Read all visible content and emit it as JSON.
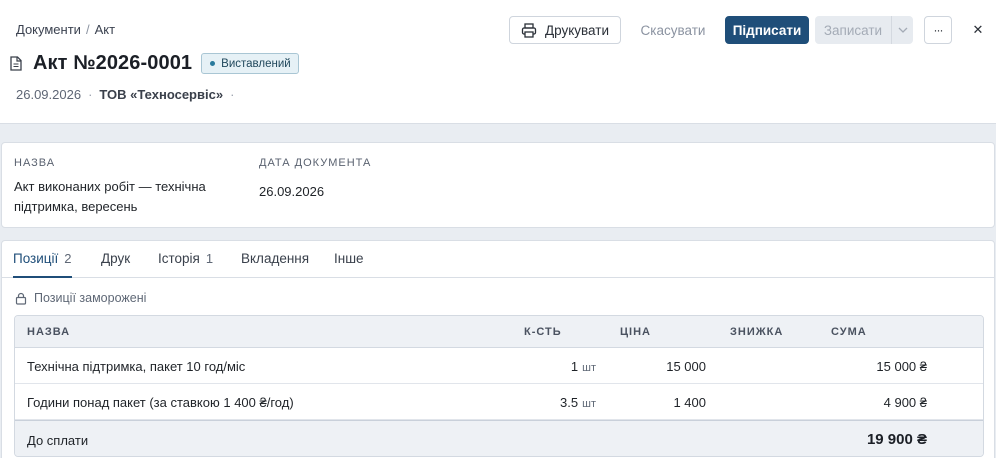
{
  "breadcrumb": {
    "parent": "Документи",
    "separator": "/",
    "current": "Акт"
  },
  "document": {
    "title": "Акт №2026-0001",
    "status": "Виставлений",
    "date": "26.09.2026",
    "organization": "ТОВ «Техносервіс»",
    "meta_separator": "·"
  },
  "toolbar": {
    "print_label": "Друкувати",
    "cancel_label": "Скасувати",
    "sign_label": "Підписати",
    "save_label": "Записати",
    "more_label": "···",
    "close_label": "✕"
  },
  "fields": {
    "name_label": "НАЗВА",
    "name_line1": "Акт виконаних робіт — технічна",
    "name_line2": "підтримка, вересень",
    "date_label": "ДАТА ДОКУМЕНТА",
    "date_value": "26.09.2026"
  },
  "tabs": [
    {
      "label": "Позиції",
      "count": "2",
      "active": true
    },
    {
      "label": "Друк",
      "count": ""
    },
    {
      "label": "Історія",
      "count": "1"
    },
    {
      "label": "Вкладення",
      "count": ""
    },
    {
      "label": "Інше",
      "count": ""
    }
  ],
  "positions": {
    "frozen_notice": "Позиції заморожені",
    "columns": {
      "name": "НАЗВА",
      "qty": "К-СТЬ",
      "price": "ЦІНА",
      "discount": "ЗНИЖКА",
      "sum": "СУМА"
    },
    "rows": [
      {
        "name": "Технічна підтримка, пакет 10 год/міс",
        "qty": "1",
        "unit": "шт",
        "price": "15 000",
        "discount": "",
        "sum": "15 000 ₴"
      },
      {
        "name": "Години понад пакет (за ставкою 1 400 ₴/год)",
        "qty": "3.5",
        "unit": "шт",
        "price": "1 400",
        "discount": "",
        "sum": "4 900 ₴"
      }
    ],
    "total_label": "До сплати",
    "total_value": "19 900 ₴"
  },
  "colors": {
    "primary": "#1f4e79",
    "status_bg": "#e6f1f6",
    "status_dot": "#2a7a9c",
    "page_bg": "#e9edf2"
  }
}
